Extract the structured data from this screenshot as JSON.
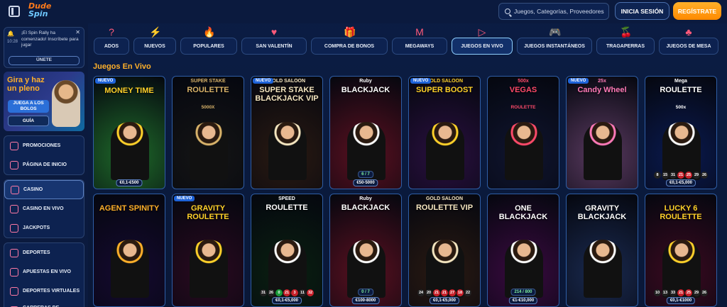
{
  "header": {
    "logo_line1": "Dude",
    "logo_line2": "Spin",
    "search_placeholder": "Juegos, Categorías, Proveedores",
    "login_label": "INICIA SESIÓN",
    "register_label": "REGÍSTRATE"
  },
  "notification": {
    "time": "10:28",
    "text": "¡El Spin Rally ha comenzado! Inscríbete para jugar",
    "join_label": "ÚNETE"
  },
  "promo": {
    "title": "Gira y haz un pleno",
    "play_label": "JUEGA A LOS BOLOS",
    "guide_label": "GUÍA"
  },
  "sidebar": {
    "group1": [
      {
        "label": "PROMOCIONES"
      },
      {
        "label": "PÁGINA DE INICIO"
      }
    ],
    "group2": [
      {
        "label": "CASINO"
      },
      {
        "label": "CASINO EN VIVO"
      },
      {
        "label": "JACKPOTS"
      }
    ],
    "group3": [
      {
        "label": "DEPORTES"
      },
      {
        "label": "APUESTAS EN VIVO"
      },
      {
        "label": "DEPORTES VIRTUALES"
      },
      {
        "label": "CARRERAS DE CABALLOS"
      }
    ]
  },
  "categories": [
    {
      "label": "ADOS",
      "icon": "?"
    },
    {
      "label": "NUEVOS",
      "icon": "⚡"
    },
    {
      "label": "POPULARES",
      "icon": "🔥"
    },
    {
      "label": "SAN VALENTÍN",
      "icon": "♥"
    },
    {
      "label": "COMPRA DE BONOS",
      "icon": "🎁"
    },
    {
      "label": "MEGAWAYS",
      "icon": "M"
    },
    {
      "label": "JUEGOS EN VIVO",
      "icon": "▷"
    },
    {
      "label": "JUEGOS INSTANTÁNEOS",
      "icon": "🎮"
    },
    {
      "label": "TRAGAPERRAS",
      "icon": "🍒"
    },
    {
      "label": "JUEGOS DE MESA",
      "icon": "♣"
    }
  ],
  "section_title": "Juegos En Vivo",
  "games_row1": [
    {
      "title": "MONEY TIME",
      "badge": "NUEVO",
      "limit": "€0,1-€500",
      "bg": "#1f6a2a",
      "accent": "#ffd12a"
    },
    {
      "title": "ROULETTE",
      "sub": "SUPER STAKE",
      "sub2": "5000X",
      "badge": "",
      "limit": "",
      "bg": "#151515",
      "accent": "#d9b36a"
    },
    {
      "title": "SUPER STAKE BLACKJACK VIP",
      "sub": "GOLD SALOON",
      "badge": "NUEVO",
      "limit": "",
      "bg": "#2a1a12",
      "accent": "#f5e6c0"
    },
    {
      "title": "BLACKJACK",
      "sub": "Ruby",
      "badge": "",
      "limit": "€50-5000",
      "seats": "6 / 7",
      "bg": "#5a1020",
      "accent": "#ffffff"
    },
    {
      "title": "SUPER BOOST",
      "sub": "GOLD SALOON",
      "badge": "NUEVO",
      "limit": "",
      "bg": "#2a1040",
      "accent": "#ffd12a"
    },
    {
      "title": "VEGAS",
      "sub": "500x",
      "sub2": "ROULETTE",
      "badge": "",
      "limit": "",
      "bg": "#101530",
      "accent": "#ff4a6a"
    },
    {
      "title": "Candy Wheel",
      "sub": "25x",
      "badge": "NUEVO",
      "limit": "",
      "bg": "#5a3a60",
      "accent": "#ff7ab8"
    },
    {
      "title": "ROULETTE",
      "sub": "Mega",
      "sub2": "500x",
      "badge": "",
      "limit": "€0,1-€5,000",
      "bg": "#0a1a50",
      "accent": "#ffffff",
      "numbers": [
        {
          "n": "8",
          "c": "b"
        },
        {
          "n": "15",
          "c": "b"
        },
        {
          "n": "31",
          "c": "b"
        },
        {
          "n": "21",
          "c": "r"
        },
        {
          "n": "25",
          "c": "r"
        },
        {
          "n": "29",
          "c": "b"
        },
        {
          "n": "26",
          "c": "b"
        }
      ]
    }
  ],
  "games_row2": [
    {
      "title": "AGENT SPINITY",
      "badge": "",
      "limit": "",
      "bg": "#150a30",
      "accent": "#ffb02a"
    },
    {
      "title": "GRAVITY ROULETTE",
      "badge": "NUEVO",
      "limit": "",
      "bg": "#2a0a20",
      "accent": "#ffd12a"
    },
    {
      "title": "ROULETTE",
      "sub": "SPEED",
      "badge": "",
      "limit": "€0,1-€5,000",
      "bg": "#0a2010",
      "accent": "#ffffff",
      "numbers": [
        {
          "n": "31",
          "c": "b"
        },
        {
          "n": "26",
          "c": "b"
        },
        {
          "n": "0",
          "c": "g"
        },
        {
          "n": "21",
          "c": "r"
        },
        {
          "n": "3",
          "c": "r"
        },
        {
          "n": "11",
          "c": "b"
        },
        {
          "n": "32",
          "c": "r"
        }
      ]
    },
    {
      "title": "BLACKJACK",
      "sub": "Ruby",
      "badge": "",
      "limit": "€100-8000",
      "seats": "0 / 7",
      "bg": "#5a1020",
      "accent": "#ffffff"
    },
    {
      "title": "ROULETTE VIP",
      "sub": "GOLD SALOON",
      "badge": "",
      "limit": "€0,1-€5,000",
      "bg": "#2a1a12",
      "accent": "#f5e6c0",
      "numbers": [
        {
          "n": "24",
          "c": "b"
        },
        {
          "n": "20",
          "c": "b"
        },
        {
          "n": "21",
          "c": "r"
        },
        {
          "n": "21",
          "c": "r"
        },
        {
          "n": "27",
          "c": "r"
        },
        {
          "n": "18",
          "c": "r"
        },
        {
          "n": "22",
          "c": "b"
        }
      ]
    },
    {
      "title": "ONE BLACKJACK",
      "badge": "",
      "limit": "€1-€10,000",
      "seats": "214 / 800",
      "bg": "#3a0a40",
      "accent": "#ffffff"
    },
    {
      "title": "GRAVITY BLACKJACK",
      "badge": "",
      "limit": "",
      "bg": "#1a2a50",
      "accent": "#ffffff"
    },
    {
      "title": "LUCKY 6 ROULETTE",
      "badge": "",
      "limit": "€0,1-€1000",
      "bg": "#3a0a20",
      "accent": "#ffd12a",
      "numbers": [
        {
          "n": "10",
          "c": "b"
        },
        {
          "n": "13",
          "c": "b"
        },
        {
          "n": "33",
          "c": "b"
        },
        {
          "n": "21",
          "c": "r"
        },
        {
          "n": "25",
          "c": "r"
        },
        {
          "n": "29",
          "c": "b"
        },
        {
          "n": "26",
          "c": "b"
        }
      ]
    }
  ]
}
